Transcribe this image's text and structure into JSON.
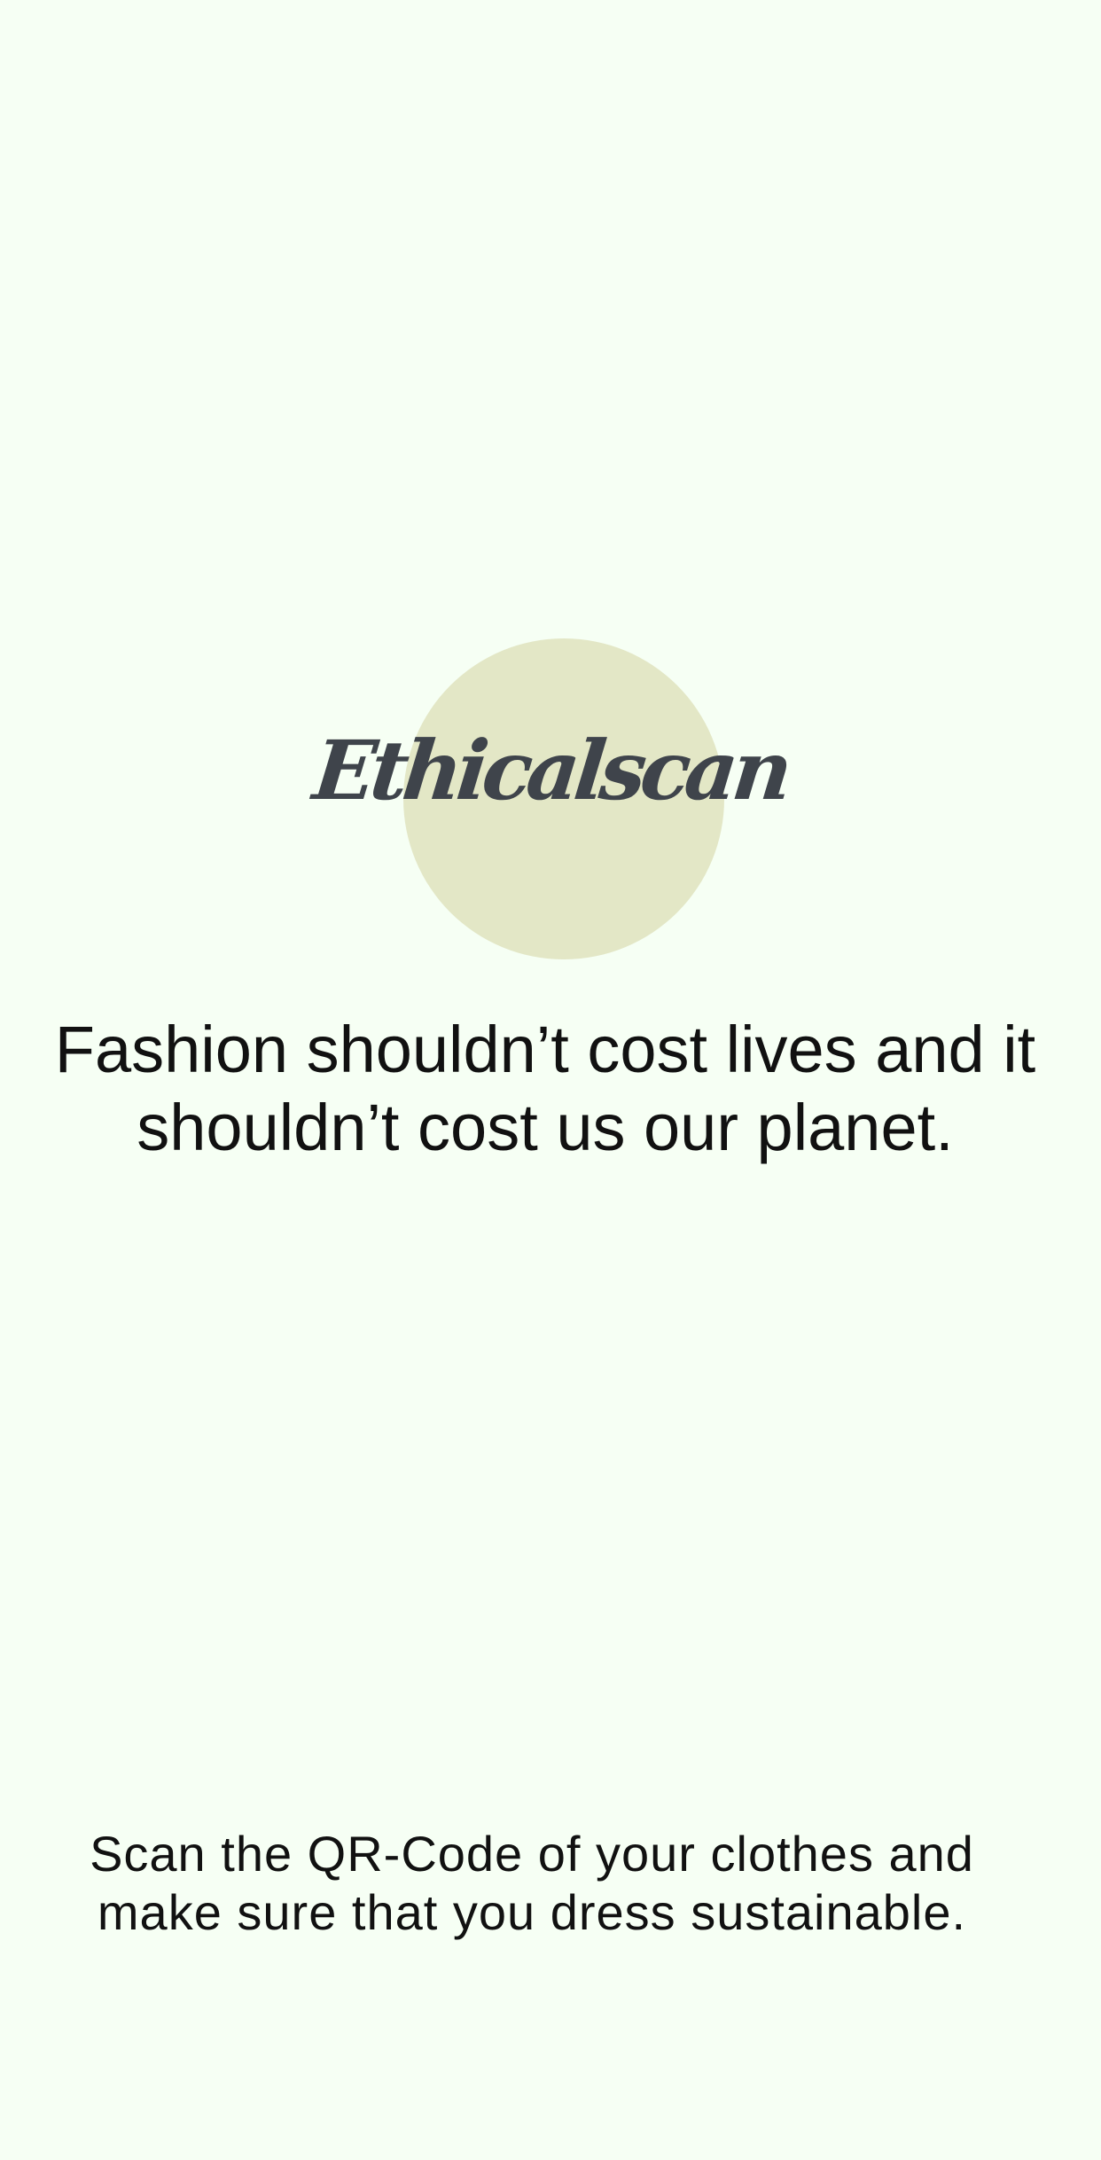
{
  "app": {
    "name": "Ethicalscan"
  },
  "logo": {
    "text": "Ethicalscan",
    "circle_color": "#e3e7c6",
    "text_color": "#3f444b"
  },
  "tagline": {
    "text": "Fashion shouldn’t cost lives and it shouldn’t cost us our planet."
  },
  "instruction": {
    "text": "Scan the QR-Code of your clothes and make sure that you dress sustainable."
  },
  "colors": {
    "background": "#f6fff4",
    "text": "#111111"
  }
}
